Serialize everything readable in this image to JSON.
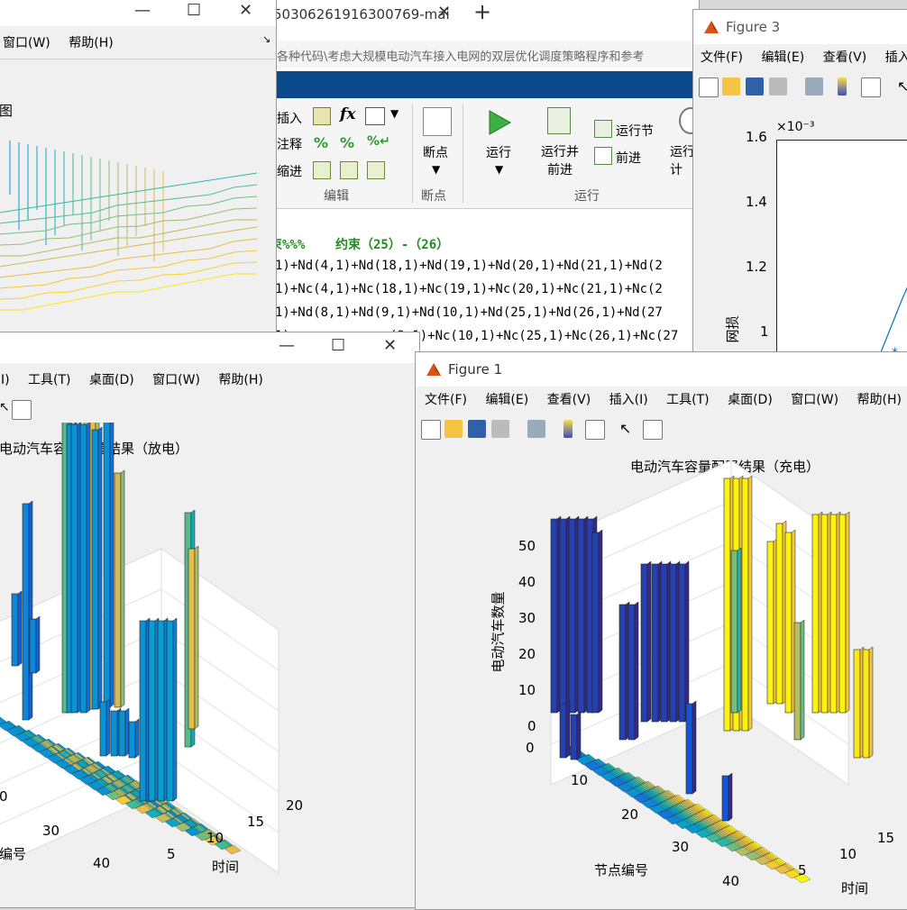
{
  "left_window": {
    "menu": [
      "窗口(W)",
      "帮助(H)"
    ],
    "plot_title_fragment": "图"
  },
  "editor": {
    "tab_title": "50306261916300769-mai",
    "path": "各种代码\\考虑大规模电动汽车接入电网的双层优化调度策略程序和参考",
    "ribbon": {
      "insert": "插入",
      "comment": "注释",
      "indent": "缩进",
      "edit_group": "编辑",
      "breakpoint": "断点",
      "breakpoint_group": "断点",
      "run": "运行",
      "run_advance": "运行并\n前进",
      "run_section": "运行节",
      "advance": "前进",
      "run_time": "运行\n计",
      "run_group": "运行"
    },
    "code_lines": [
      "束%%%    约束（25）-（26）",
      "1)+Nd(4,1)+Nd(18,1)+Nd(19,1)+Nd(20,1)+Nd(21,1)+Nd(2",
      "1)+Nc(4,1)+Nc(18,1)+Nc(19,1)+Nc(20,1)+Nc(21,1)+Nc(2",
      "1)+Nd(8,1)+Nd(9,1)+Nd(10,1)+Nd(25,1)+Nd(26,1)+Nd(27",
      "(9,1)+Nc(10,1)+Nc(25,1)+Nc(26,1)+Nc(27"
    ],
    "code_visible_prefix_line4": "1)"
  },
  "figure3": {
    "title": "Figure 3",
    "menu": [
      "文件(F)",
      "编辑(E)",
      "查看(V)",
      "插入("
    ],
    "exponent": "×10⁻³",
    "yticks": [
      "1.6",
      "1.4",
      "1.2",
      "1"
    ],
    "ylabel": "网损"
  },
  "figure_discharge": {
    "menu": [
      "I)",
      "工具(T)",
      "桌面(D)",
      "窗口(W)",
      "帮助(H)"
    ],
    "title": "电动汽车容量配置结果（放电）",
    "x_ticks": [
      "20",
      "15",
      "10",
      "5"
    ],
    "x_label": "时间",
    "y_ticks": [
      "0",
      "30",
      "40"
    ],
    "y_label": "编号"
  },
  "figure1": {
    "title": "Figure 1",
    "menu": [
      "文件(F)",
      "编辑(E)",
      "查看(V)",
      "插入(I)",
      "工具(T)",
      "桌面(D)",
      "窗口(W)",
      "帮助(H)"
    ],
    "plot_title": "电动汽车容量配置结果（充电）",
    "z_ticks": [
      "50",
      "40",
      "30",
      "20",
      "10",
      "0"
    ],
    "z_label": "电动汽车数量",
    "y_ticks": [
      "0",
      "10",
      "20",
      "30",
      "40"
    ],
    "y_label": "节点编号",
    "x_ticks": [
      "5",
      "10",
      "15"
    ],
    "x_label": "时间"
  },
  "colors": {
    "matlab_blue": "#0a4a8c",
    "run_green": "#3cb043",
    "code_green": "#228b22"
  }
}
